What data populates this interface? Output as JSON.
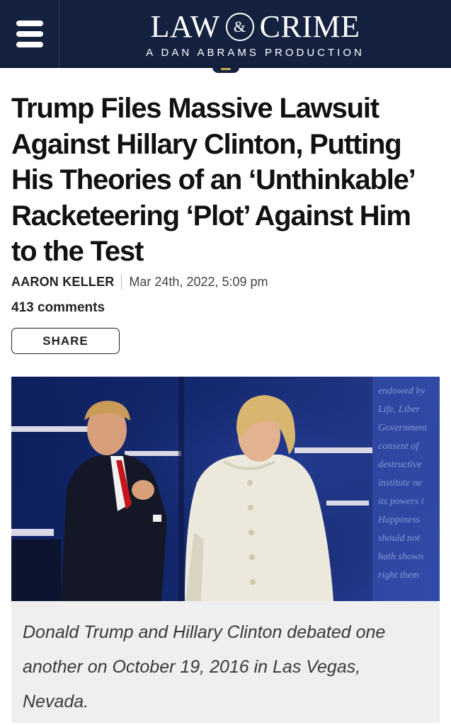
{
  "header": {
    "logo_left": "LAW",
    "logo_amp": "&",
    "logo_right": "CRIME",
    "tagline": "A DAN ABRAMS PRODUCTION",
    "menu_icon": "hamburger-menu-icon"
  },
  "article": {
    "headline": "Trump Files Massive Lawsuit Against Hillary Clinton, Putting His Theories of an ‘Unthinkable’ Racketeering ‘Plot’ Against Him to the Test",
    "author": "AARON KELLER",
    "date": "Mar 24th, 2022, 5:09 pm",
    "comments": "413 comments",
    "share_label": "SHARE"
  },
  "photo": {
    "backdrop_words": [
      "endowed by",
      "Life, Liber",
      "Government",
      "consent of",
      "destructive",
      "institute ne",
      "its powers i",
      "Happiness",
      "should not",
      "hath shown",
      "right them"
    ],
    "caption": "Donald Trump and Hillary Clinton debated one another on October 19, 2016 in Las Vegas, Nevada."
  },
  "colors": {
    "nav_bg": "#142240",
    "accent_gold": "#c9a94d",
    "caption_bg": "#efefef"
  }
}
